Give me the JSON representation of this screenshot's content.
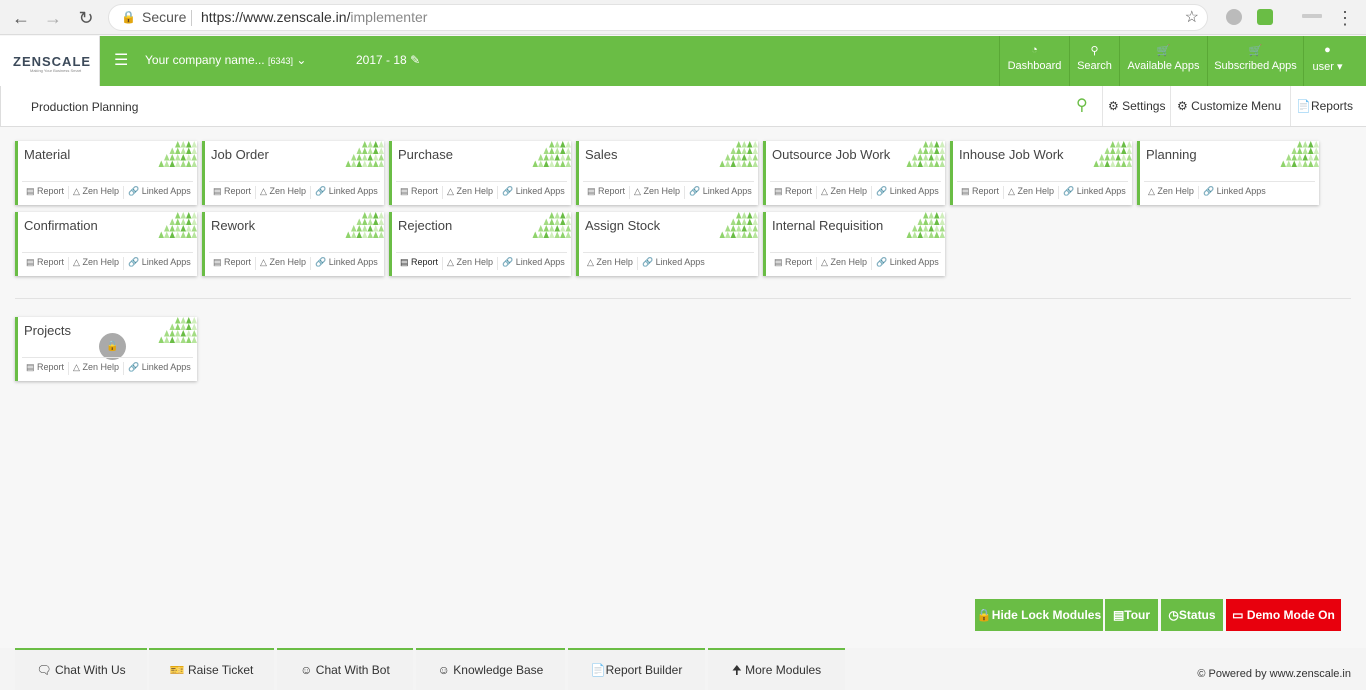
{
  "browser": {
    "secure_label": "Secure",
    "url_host": "https://www.zenscale.in/",
    "url_path": "implementer"
  },
  "header": {
    "logo_text": "ZENSCALE",
    "logo_tagline": "Making Your Business Smart",
    "company_label": "Your company name...",
    "company_id": "[6343]",
    "year": "2017 - 18",
    "nav": [
      {
        "label": "Dashboard",
        "icon": "dashboard-icon"
      },
      {
        "label": "Search",
        "icon": "search-icon"
      },
      {
        "label": "Available Apps",
        "icon": "cart-icon"
      },
      {
        "label": "Subscribed Apps",
        "icon": "cart-icon"
      },
      {
        "label": "user",
        "icon": "user-icon"
      }
    ]
  },
  "subheader": {
    "title": "Production Planning",
    "settings": "Settings",
    "customize": "Customize Menu",
    "reports": "Reports"
  },
  "links": {
    "report": "Report",
    "zenhelp": "Zen Help",
    "linked": "Linked Apps"
  },
  "modules": [
    {
      "title": "Material"
    },
    {
      "title": "Job Order"
    },
    {
      "title": "Purchase"
    },
    {
      "title": "Sales"
    },
    {
      "title": "Outsource Job Work"
    },
    {
      "title": "Inhouse Job Work"
    },
    {
      "title": "Planning"
    },
    {
      "title": "Confirmation"
    },
    {
      "title": "Rework"
    },
    {
      "title": "Rejection"
    },
    {
      "title": "Assign Stock"
    },
    {
      "title": "Internal Requisition"
    }
  ],
  "locked_modules": [
    {
      "title": "Projects"
    }
  ],
  "actions": {
    "hide_lock": "Hide Lock Modules",
    "tour": "Tour",
    "status": "Status",
    "demo": "Demo Mode On"
  },
  "footer": {
    "tabs": [
      "Chat With Us",
      "Raise Ticket",
      "Chat With Bot",
      "Knowledge Base",
      "Report Builder",
      "More Modules"
    ],
    "powered": "© Powered by www.zenscale.in"
  },
  "colors": {
    "brand_green": "#6abd45",
    "demo_red": "#e8000d"
  }
}
